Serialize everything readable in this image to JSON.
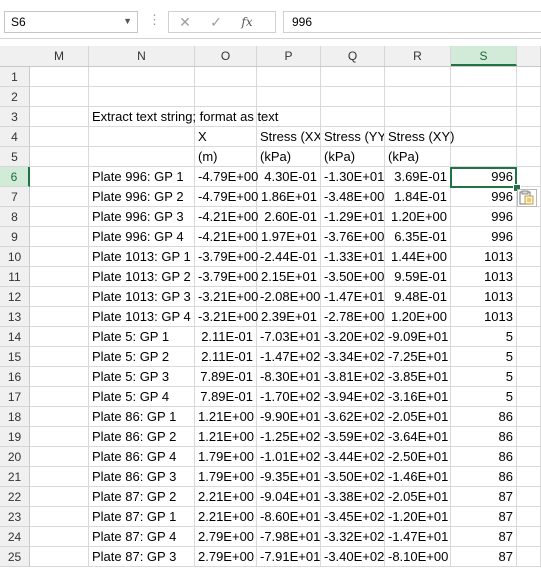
{
  "formula_bar": {
    "name_box": "S6",
    "cancel_glyph": "✕",
    "enter_glyph": "✓",
    "fx_label": "fx",
    "formula": "996"
  },
  "columns": [
    "M",
    "N",
    "O",
    "P",
    "Q",
    "R",
    "S"
  ],
  "selected_column": "S",
  "selected_row": "6",
  "rows": [
    {
      "num": "1"
    },
    {
      "num": "2"
    },
    {
      "num": "3",
      "N": "Extract text string; format as text"
    },
    {
      "num": "4",
      "O": "X",
      "P": "Stress (XX",
      "Q": "Stress (YY",
      "R": "Stress (XY)"
    },
    {
      "num": "5",
      "O": "(m)",
      "P": "(kPa)",
      "Q": "(kPa)",
      "R": "(kPa)"
    },
    {
      "num": "6",
      "N": "Plate 996: GP 1",
      "O": "-4.79E+00",
      "P": "4.30E-01",
      "Q": "-1.30E+01",
      "R": "3.69E-01",
      "S": "996"
    },
    {
      "num": "7",
      "N": "Plate 996: GP 2",
      "O": "-4.79E+00",
      "P": "1.86E+01",
      "Q": "-3.48E+00",
      "R": "1.84E-01",
      "S": "996"
    },
    {
      "num": "8",
      "N": "Plate 996: GP 3",
      "O": "-4.21E+00",
      "P": "2.60E-01",
      "Q": "-1.29E+01",
      "R": "1.20E+00",
      "S": "996"
    },
    {
      "num": "9",
      "N": "Plate 996: GP 4",
      "O": "-4.21E+00",
      "P": "1.97E+01",
      "Q": "-3.76E+00",
      "R": "6.35E-01",
      "S": "996"
    },
    {
      "num": "10",
      "N": "Plate 1013: GP 1",
      "O": "-3.79E+00",
      "P": "-2.44E-01",
      "Q": "-1.33E+01",
      "R": "1.44E+00",
      "S": "1013"
    },
    {
      "num": "11",
      "N": "Plate 1013: GP 2",
      "O": "-3.79E+00",
      "P": "2.15E+01",
      "Q": "-3.50E+00",
      "R": "9.59E-01",
      "S": "1013"
    },
    {
      "num": "12",
      "N": "Plate 1013: GP 3",
      "O": "-3.21E+00",
      "P": "-2.08E+00",
      "Q": "-1.47E+01",
      "R": "9.48E-01",
      "S": "1013"
    },
    {
      "num": "13",
      "N": "Plate 1013: GP 4",
      "O": "-3.21E+00",
      "P": "2.39E+01",
      "Q": "-2.78E+00",
      "R": "1.20E+00",
      "S": "1013"
    },
    {
      "num": "14",
      "N": "Plate 5: GP 1",
      "O": "2.11E-01",
      "P": "-7.03E+01",
      "Q": "-3.20E+02",
      "R": "-9.09E+01",
      "S": "5"
    },
    {
      "num": "15",
      "N": "Plate 5: GP 2",
      "O": "2.11E-01",
      "P": "-1.47E+02",
      "Q": "-3.34E+02",
      "R": "-7.25E+01",
      "S": "5"
    },
    {
      "num": "16",
      "N": "Plate 5: GP 3",
      "O": "7.89E-01",
      "P": "-8.30E+01",
      "Q": "-3.81E+02",
      "R": "-3.85E+01",
      "S": "5"
    },
    {
      "num": "17",
      "N": "Plate 5: GP 4",
      "O": "7.89E-01",
      "P": "-1.70E+02",
      "Q": "-3.94E+02",
      "R": "-3.16E+01",
      "S": "5"
    },
    {
      "num": "18",
      "N": "Plate 86: GP 1",
      "O": "1.21E+00",
      "P": "-9.90E+01",
      "Q": "-3.62E+02",
      "R": "-2.05E+01",
      "S": "86"
    },
    {
      "num": "19",
      "N": "Plate 86: GP 2",
      "O": "1.21E+00",
      "P": "-1.25E+02",
      "Q": "-3.59E+02",
      "R": "-3.64E+01",
      "S": "86"
    },
    {
      "num": "20",
      "N": "Plate 86: GP 4",
      "O": "1.79E+00",
      "P": "-1.01E+02",
      "Q": "-3.44E+02",
      "R": "-2.50E+01",
      "S": "86"
    },
    {
      "num": "21",
      "N": "Plate 86: GP 3",
      "O": "1.79E+00",
      "P": "-9.35E+01",
      "Q": "-3.50E+02",
      "R": "-1.46E+01",
      "S": "86"
    },
    {
      "num": "22",
      "N": "Plate 87: GP 2",
      "O": "2.21E+00",
      "P": "-9.04E+01",
      "Q": "-3.38E+02",
      "R": "-2.05E+01",
      "S": "87"
    },
    {
      "num": "23",
      "N": "Plate 87: GP 1",
      "O": "2.21E+00",
      "P": "-8.60E+01",
      "Q": "-3.45E+02",
      "R": "-1.20E+01",
      "S": "87"
    },
    {
      "num": "24",
      "N": "Plate 87: GP 4",
      "O": "2.79E+00",
      "P": "-7.98E+01",
      "Q": "-3.32E+02",
      "R": "-1.47E+01",
      "S": "87"
    },
    {
      "num": "25",
      "N": "Plate 87: GP 3",
      "O": "2.79E+00",
      "P": "-7.91E+01",
      "Q": "-3.40E+02",
      "R": "-8.10E+00",
      "S": "87"
    }
  ]
}
